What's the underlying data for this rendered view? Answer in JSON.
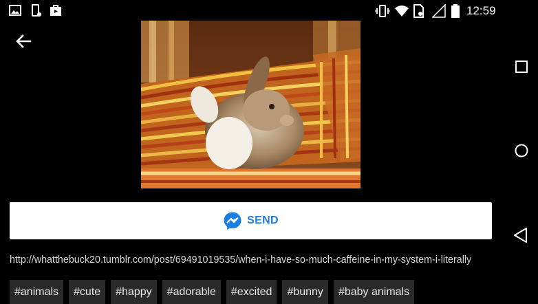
{
  "status_bar": {
    "time": "12:59",
    "left_icons": [
      "gallery-notification-icon",
      "phone-notification-icon",
      "store-notification-icon"
    ],
    "right_icons": [
      "vibrate-icon",
      "wifi-icon",
      "sim-icon",
      "no-signal-icon",
      "battery-icon"
    ]
  },
  "nav": {
    "back_icon": "arrow-left-icon"
  },
  "gif": {
    "subject_icon": "bunny-image"
  },
  "send_button": {
    "label": "SEND",
    "icon": "messenger-icon",
    "color": "#1a7fe0"
  },
  "source_url": "http://whatthebuck20.tumblr.com/post/69491019535/when-i-have-so-much-caffeine-in-my-system-i-literally",
  "tags": [
    "#animals",
    "#cute",
    "#happy",
    "#adorable",
    "#excited",
    "#bunny",
    "#baby animals"
  ],
  "system_nav": {
    "buttons": [
      "recents-icon",
      "home-icon",
      "back-triangle-icon"
    ]
  }
}
